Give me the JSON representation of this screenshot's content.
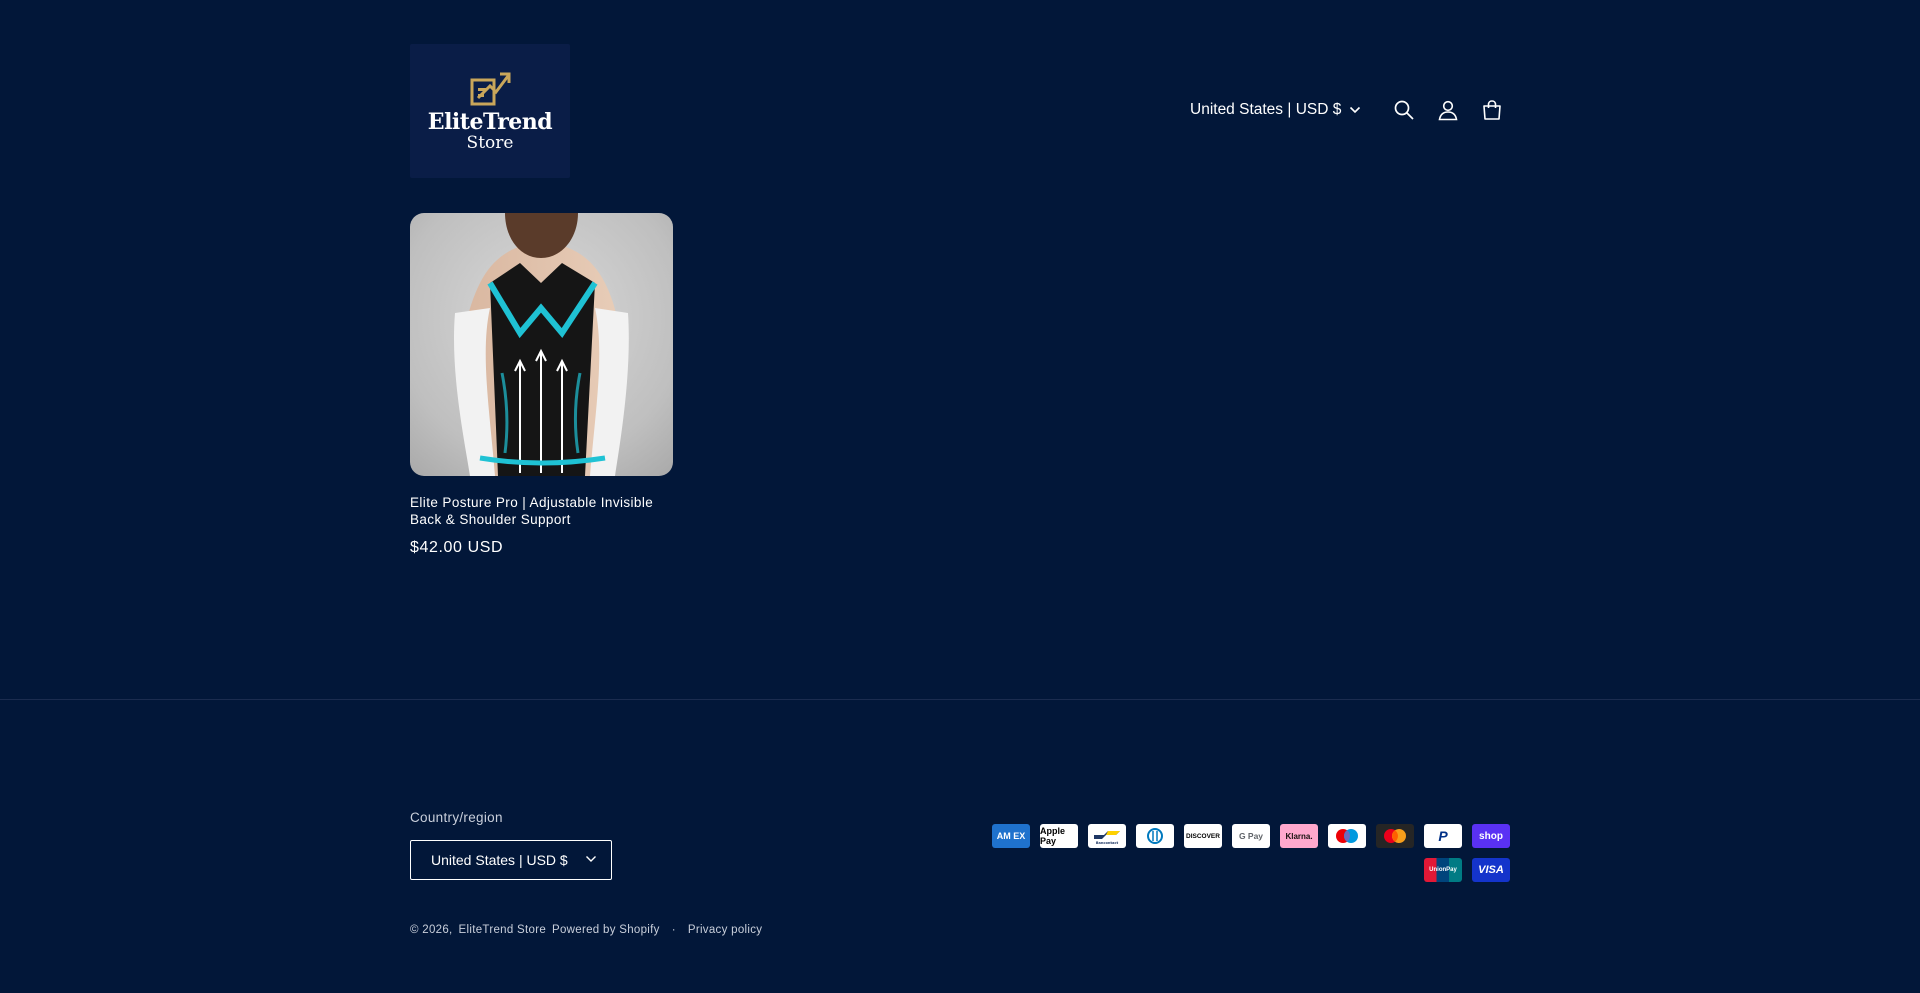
{
  "header": {
    "logo": {
      "name": "EliteTrend",
      "sub": "Store"
    },
    "country_selector": "United States | USD $",
    "icons": [
      "search-icon",
      "account-icon",
      "cart-icon"
    ]
  },
  "product": {
    "title": "Elite Posture Pro | Adjustable Invisible Back & Shoulder Support",
    "price": "$42.00 USD"
  },
  "footer": {
    "country_label": "Country/region",
    "country_value": "United States | USD $",
    "payments": [
      {
        "name": "American Express",
        "label": "AM EX"
      },
      {
        "name": "Apple Pay",
        "label": "Apple Pay"
      },
      {
        "name": "Bancontact",
        "label": "Bancontact"
      },
      {
        "name": "Diners Club",
        "label": "D"
      },
      {
        "name": "Discover",
        "label": "DISCOVER"
      },
      {
        "name": "Google Pay",
        "label": "G Pay"
      },
      {
        "name": "Klarna",
        "label": "Klarna."
      },
      {
        "name": "Maestro",
        "label": ""
      },
      {
        "name": "Mastercard",
        "label": ""
      },
      {
        "name": "PayPal",
        "label": "P"
      },
      {
        "name": "Shop Pay",
        "label": "shop"
      },
      {
        "name": "UnionPay",
        "label": "UnionPay"
      },
      {
        "name": "Visa",
        "label": "VISA"
      }
    ],
    "copyright_prefix": "© 2026,",
    "store_link": "EliteTrend Store",
    "powered_by": "Powered by Shopify",
    "separator": "·",
    "privacy_policy": "Privacy policy"
  },
  "colors": {
    "background": "#021739",
    "logo_bg": "#0a1d47",
    "logo_gold": "#c9a65a",
    "text": "#ffffff",
    "muted_text": "#c9cfdb",
    "divider": "#1b2c4f"
  }
}
